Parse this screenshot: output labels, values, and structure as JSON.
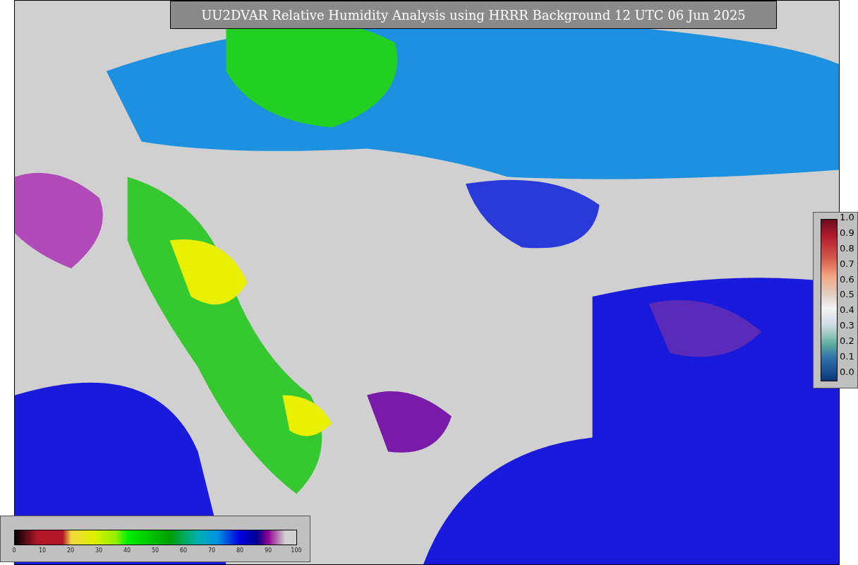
{
  "title": "UU2DVAR Relative Humidity Analysis using HRRR Background 12 UTC 06 Jun 2025",
  "side_colorbar": {
    "ticks": [
      "1.0",
      "0.9",
      "0.8",
      "0.7",
      "0.6",
      "0.5",
      "0.4",
      "0.3",
      "0.2",
      "0.1",
      "0.0"
    ]
  },
  "bottom_colorbar": {
    "ticks": [
      "0",
      "10",
      "20",
      "30",
      "40",
      "50",
      "60",
      "70",
      "80",
      "90",
      "100"
    ]
  }
}
